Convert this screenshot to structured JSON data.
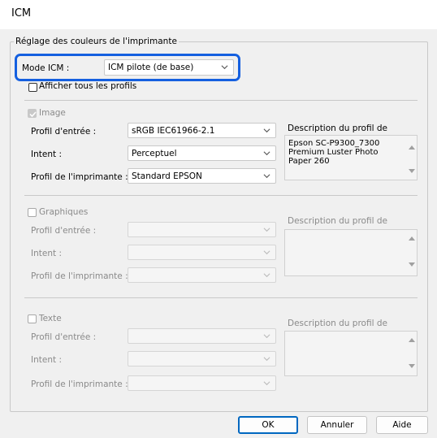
{
  "window": {
    "title": "ICM"
  },
  "group": {
    "legend": "Réglage des couleurs de l'imprimante"
  },
  "mode": {
    "label": "Mode ICM :",
    "value": "ICM pilote (de base)"
  },
  "show_all_profiles": {
    "label": "Afficher tous les profils"
  },
  "image": {
    "label": "Image",
    "input_profile_label": "Profil d'entrée :",
    "input_profile_value": "sRGB IEC61966-2.1",
    "intent_label": "Intent :",
    "intent_value": "Perceptuel",
    "printer_profile_label": "Profil de l'imprimante :",
    "printer_profile_value": "Standard EPSON",
    "description_label": "Description du profil de",
    "description_text": "Epson SC-P9300_7300 Premium Luster Photo Paper 260"
  },
  "graphics": {
    "label": "Graphiques",
    "input_profile_label": "Profil d'entrée :",
    "intent_label": "Intent :",
    "printer_profile_label": "Profil de l'imprimante :",
    "description_label": "Description du profil de"
  },
  "text": {
    "label": "Texte",
    "input_profile_label": "Profil d'entrée :",
    "intent_label": "Intent :",
    "printer_profile_label": "Profil de l'imprimante :",
    "description_label": "Description du profil de"
  },
  "buttons": {
    "ok": "OK",
    "cancel": "Annuler",
    "help": "Aide"
  },
  "colors": {
    "highlight": "#1560e0",
    "default_button": "#0067c0"
  }
}
